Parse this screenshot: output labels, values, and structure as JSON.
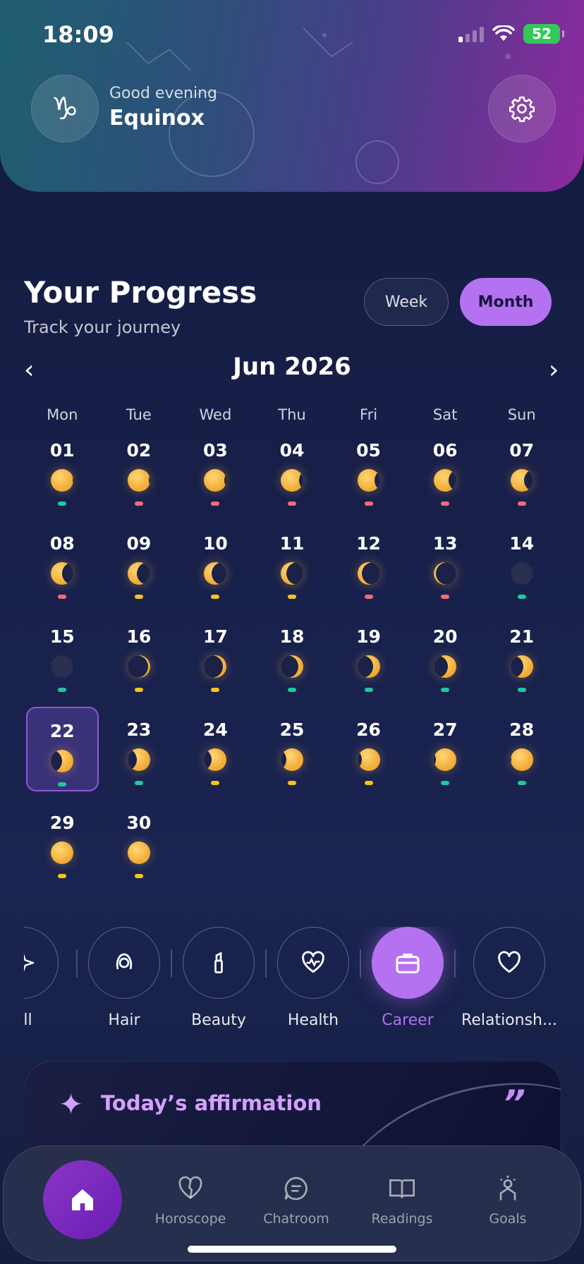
{
  "status_bar": {
    "time": "18:09",
    "battery": "52"
  },
  "header": {
    "zodiac_symbol": "♑",
    "greeting": "Good evening",
    "username": "Equinox"
  },
  "progress": {
    "title": "Your Progress",
    "subtitle": "Track your journey",
    "week_label": "Week",
    "month_label": "Month",
    "active_toggle": "Month"
  },
  "calendar": {
    "month_title": "Jun 2026",
    "prev_label": "‹",
    "next_label": "›",
    "weekdays": [
      "Mon",
      "Tue",
      "Wed",
      "Thu",
      "Fri",
      "Sat",
      "Sun"
    ],
    "selected_day": "22",
    "days": [
      {
        "n": "01",
        "dot": "teal",
        "phase": 0.02
      },
      {
        "n": "02",
        "dot": "red",
        "phase": 0.05
      },
      {
        "n": "03",
        "dot": "red",
        "phase": 0.1
      },
      {
        "n": "04",
        "dot": "red",
        "phase": 0.18
      },
      {
        "n": "05",
        "dot": "red",
        "phase": 0.25
      },
      {
        "n": "06",
        "dot": "red",
        "phase": 0.33
      },
      {
        "n": "07",
        "dot": "red",
        "phase": 0.4
      },
      {
        "n": "08",
        "dot": "red",
        "phase": 0.5
      },
      {
        "n": "09",
        "dot": "yellow",
        "phase": 0.58
      },
      {
        "n": "10",
        "dot": "yellow",
        "phase": 0.66
      },
      {
        "n": "11",
        "dot": "yellow",
        "phase": 0.74
      },
      {
        "n": "12",
        "dot": "red",
        "phase": 0.82
      },
      {
        "n": "13",
        "dot": "red",
        "phase": 0.9
      },
      {
        "n": "14",
        "dot": "teal",
        "phase": 1.0
      },
      {
        "n": "15",
        "dot": "teal",
        "phase": 1.0
      },
      {
        "n": "16",
        "dot": "yellow",
        "phase": 0.92
      },
      {
        "n": "17",
        "dot": "yellow",
        "phase": 0.85
      },
      {
        "n": "18",
        "dot": "teal",
        "phase": 0.78
      },
      {
        "n": "19",
        "dot": "teal",
        "phase": 0.7
      },
      {
        "n": "20",
        "dot": "teal",
        "phase": 0.62
      },
      {
        "n": "21",
        "dot": "teal",
        "phase": 0.55
      },
      {
        "n": "22",
        "dot": "teal",
        "phase": 0.5
      },
      {
        "n": "23",
        "dot": "teal",
        "phase": 0.42
      },
      {
        "n": "24",
        "dot": "yellow",
        "phase": 0.34
      },
      {
        "n": "25",
        "dot": "yellow",
        "phase": 0.26
      },
      {
        "n": "26",
        "dot": "yellow",
        "phase": 0.18
      },
      {
        "n": "27",
        "dot": "teal",
        "phase": 0.1
      },
      {
        "n": "28",
        "dot": "teal",
        "phase": 0.04
      },
      {
        "n": "29",
        "dot": "yellow",
        "phase": 0.0
      },
      {
        "n": "30",
        "dot": "yellow",
        "phase": 0.0
      }
    ]
  },
  "colors": {
    "accent": "#b472f0",
    "dot_teal": "#1fc8a0",
    "dot_red": "#f36b7a",
    "dot_yellow": "#f5c518",
    "moon": "#f0b040"
  },
  "categories": [
    {
      "label": "All",
      "icon": "sparkle-icon"
    },
    {
      "label": "Hair",
      "icon": "hair-icon"
    },
    {
      "label": "Beauty",
      "icon": "lipstick-icon"
    },
    {
      "label": "Health",
      "icon": "heart-pulse-icon"
    },
    {
      "label": "Career",
      "icon": "briefcase-icon",
      "active": true
    },
    {
      "label": "Relationsh...",
      "icon": "heart-icon"
    }
  ],
  "affirmation": {
    "title": "Today’s affirmation",
    "quote_mark": "”"
  },
  "tabbar": {
    "home_icon": "home-icon",
    "items": [
      {
        "label": "Horoscope",
        "icon": "horoscope-heart-icon"
      },
      {
        "label": "Chatroom",
        "icon": "chat-icon"
      },
      {
        "label": "Readings",
        "icon": "book-icon"
      },
      {
        "label": "Goals",
        "icon": "goals-icon"
      }
    ]
  }
}
